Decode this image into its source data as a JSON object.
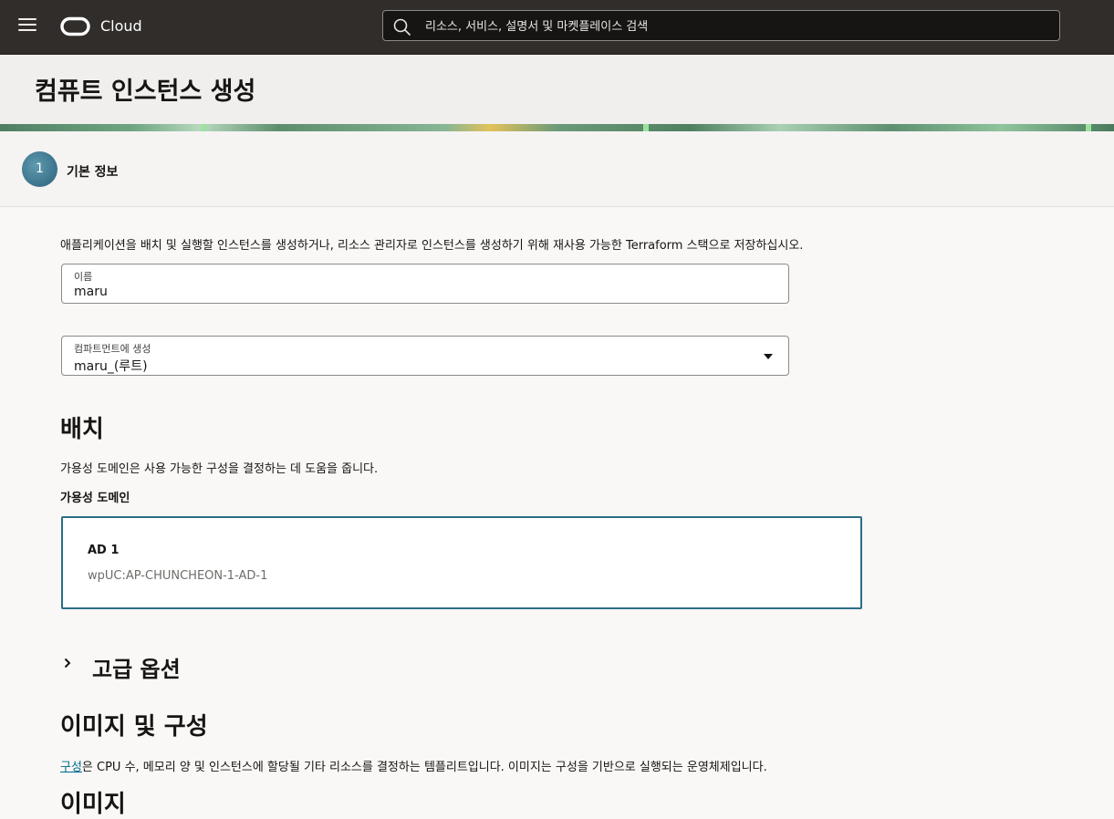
{
  "topbar": {
    "brand": "Cloud",
    "search_placeholder": "리소스, 서비스, 설명서 및 마켓플레이스 검색"
  },
  "page": {
    "title": "컴퓨트 인스턴스 생성"
  },
  "stepper": {
    "step_number": "1",
    "step_label": "기본 정보"
  },
  "basic_info": {
    "description": "애플리케이션을 배치 및 실행할 인스턴스를 생성하거나, 리소스 관리자로 인스턴스를 생성하기 위해 재사용 가능한 Terraform 스택으로 저장하십시오.",
    "name_label": "이름",
    "name_value": "maru",
    "compartment_label": "컴파트먼트에 생성",
    "compartment_value": "maru_(루트)"
  },
  "placement": {
    "heading": "배치",
    "description": "가용성 도메인은 사용 가능한 구성을 결정하는 데 도움을 줍니다.",
    "ad_label": "가용성 도메인",
    "ad_name": "AD 1",
    "ad_id": "wpUC:AP-CHUNCHEON-1-AD-1"
  },
  "advanced": {
    "heading": "고급 옵션"
  },
  "image_shape": {
    "heading": "이미지 및 구성",
    "shape_link": "구성",
    "description_rest": "은 CPU 수, 메모리 양 및 인스턴스에 할당될 기타 리소스를 결정하는 템플리트입니다. 이미지는 구성을 기반으로 실행되는 운영체제입니다.",
    "image_heading": "이미지"
  },
  "colors": {
    "topbar": "#312d2a",
    "accent": "#2d6d86",
    "link": "#00688c"
  },
  "icons": [
    "hamburger-menu-icon",
    "oracle-logo-icon",
    "search-icon",
    "chevron-down-icon",
    "chevron-right-icon"
  ]
}
